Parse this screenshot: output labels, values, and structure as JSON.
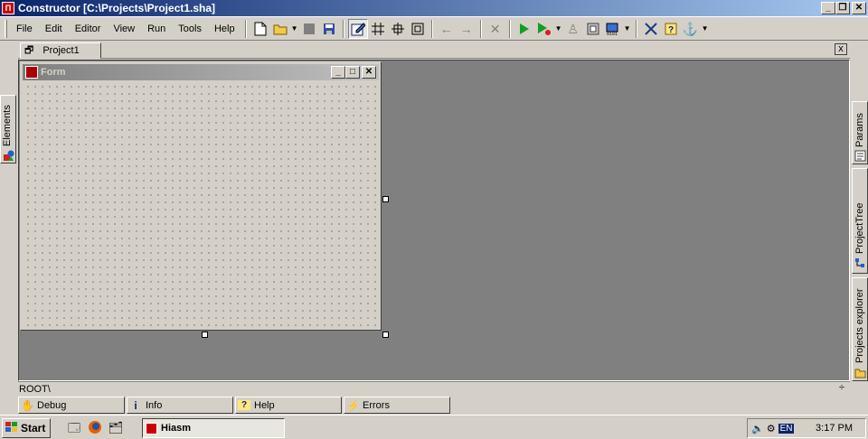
{
  "window": {
    "title": "Constructor [C:\\Projects\\Project1.sha]",
    "min_label": "_",
    "max_label": "❐",
    "close_label": "✕"
  },
  "menu": [
    "File",
    "Edit",
    "Editor",
    "View",
    "Run",
    "Tools",
    "Help"
  ],
  "toolbar": {
    "icons": [
      "new-file-icon",
      "open-folder-icon",
      "stop-icon",
      "save-icon",
      "edit-mode-icon",
      "grid-icon",
      "snap-icon",
      "fit-icon",
      "undo-icon",
      "redo-icon",
      "delete-icon",
      "run-icon",
      "debug-run-icon",
      "plugin-icon",
      "compile-icon",
      "export-icon",
      "tools-icon",
      "help-icon",
      "anchor-icon"
    ]
  },
  "doc_tab": {
    "label": "Project1",
    "close_label": "x"
  },
  "form_window": {
    "title": "Form",
    "min_label": "_",
    "max_label": "□",
    "close_label": "✕"
  },
  "status": {
    "path": "ROOT\\"
  },
  "bottom_tabs": [
    "Debug",
    "Info",
    "Help",
    "Errors"
  ],
  "side_panels": {
    "left": "Elements",
    "right": [
      "Params",
      "ProjectTree",
      "Projects explorer"
    ]
  },
  "taskbar": {
    "start_label": "Start",
    "app_label": "Hiasm",
    "lang": "EN",
    "clock": "3:17 PM"
  }
}
